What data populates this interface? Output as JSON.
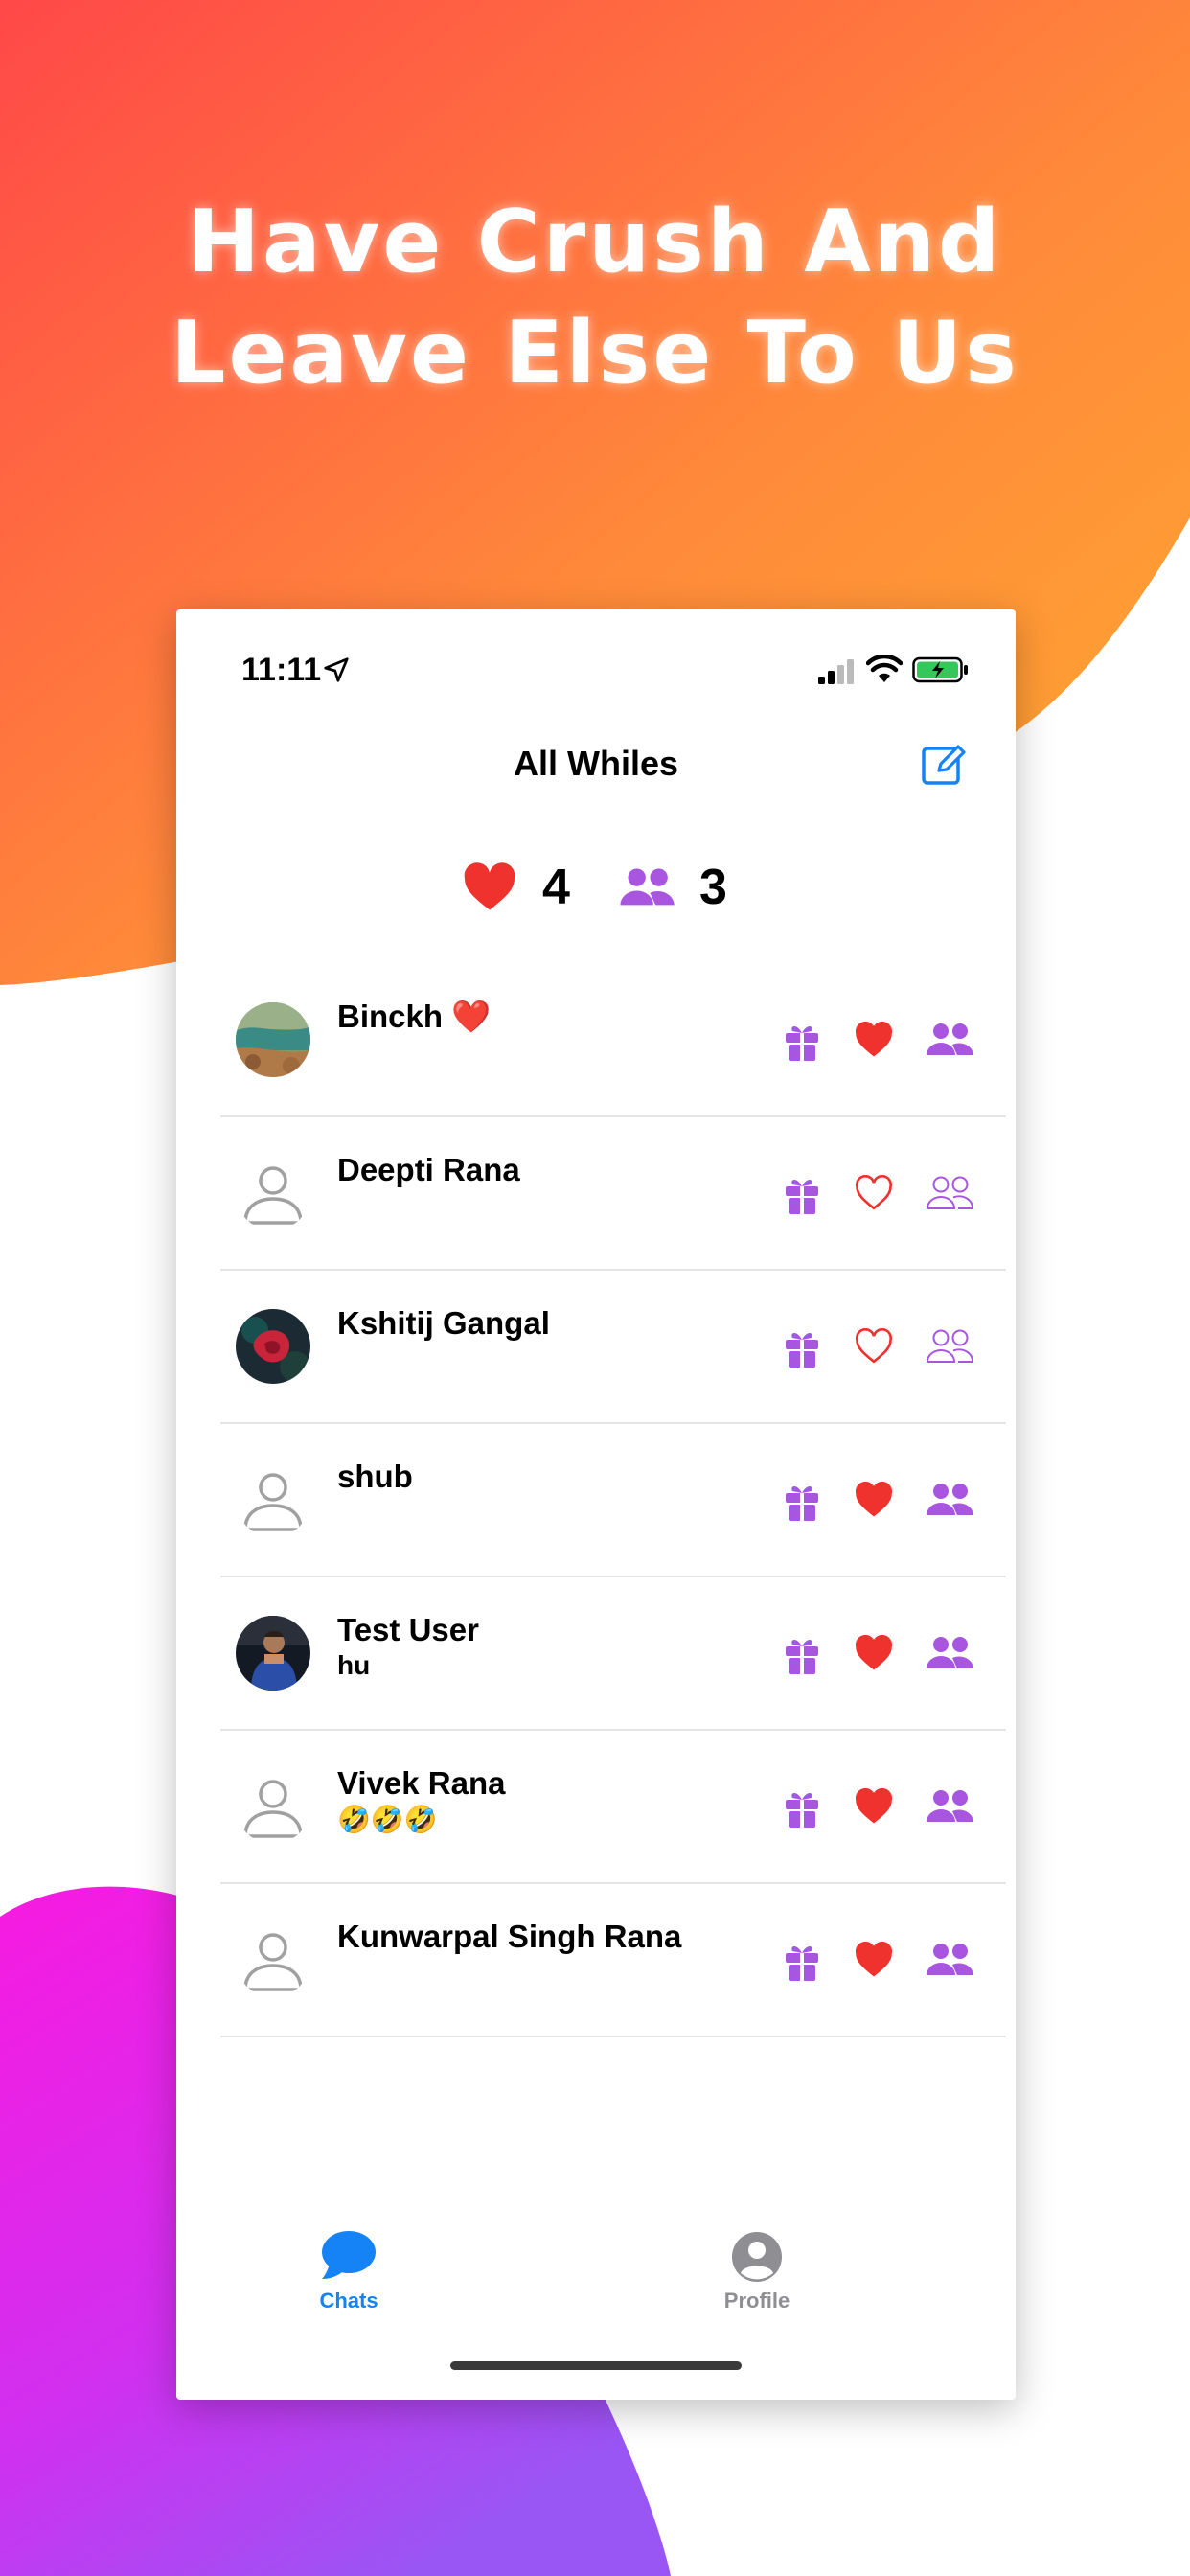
{
  "promo": {
    "headline_line1": "Have Crush And",
    "headline_line2": "Leave Else To Us"
  },
  "colors": {
    "accent_purple": "#A855E0",
    "heart_red": "#F0322E",
    "ios_blue": "#1583F5",
    "gray": "#9a9a9a"
  },
  "status_bar": {
    "time": "11:11",
    "icons": [
      "location-arrow-icon",
      "cellular-signal-icon",
      "wifi-icon",
      "battery-charging-icon"
    ]
  },
  "nav": {
    "title": "All Whiles",
    "right_icon": "compose-icon"
  },
  "stats": {
    "hearts_count": "4",
    "friends_count": "3"
  },
  "contacts": [
    {
      "name": "Binckh ❤️",
      "subtitle": "",
      "avatar": "photo-landscape",
      "heart_filled": true,
      "friends_filled": true
    },
    {
      "name": "Deepti Rana",
      "subtitle": "",
      "avatar": "placeholder",
      "heart_filled": false,
      "friends_filled": false
    },
    {
      "name": "Kshitij Gangal",
      "subtitle": "",
      "avatar": "photo-red",
      "heart_filled": false,
      "friends_filled": false
    },
    {
      "name": "shub",
      "subtitle": "",
      "avatar": "placeholder",
      "heart_filled": true,
      "friends_filled": true
    },
    {
      "name": "Test User",
      "subtitle": "hu",
      "avatar": "photo-person",
      "heart_filled": true,
      "friends_filled": true
    },
    {
      "name": "Vivek Rana",
      "subtitle": "🤣🤣🤣",
      "avatar": "placeholder",
      "heart_filled": true,
      "friends_filled": true
    },
    {
      "name": "Kunwarpal Singh Rana",
      "subtitle": "",
      "avatar": "placeholder",
      "heart_filled": true,
      "friends_filled": true
    }
  ],
  "tabs": [
    {
      "label": "Chats",
      "icon": "chat-bubble-icon",
      "active": true
    },
    {
      "label": "Profile",
      "icon": "profile-circle-icon",
      "active": false
    }
  ]
}
